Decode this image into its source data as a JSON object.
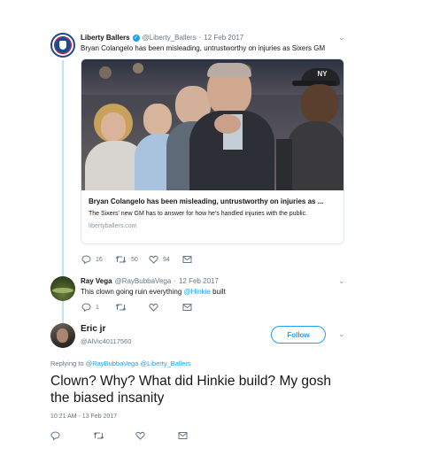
{
  "thread": [
    {
      "author_name": "Liberty Ballers",
      "verified": true,
      "handle": "@Liberty_Ballers",
      "date": "12 Feb 2017",
      "separator": "·",
      "text": "Bryan Colangelo has been misleading, untrustworthy on injuries as Sixers GM",
      "card": {
        "title": "Bryan Colangelo has been misleading, untrustworthy on injuries as ...",
        "description": "The Sixers' new GM has to answer for how he's handled injuries with the public.",
        "domain": "libertyballers.com",
        "image_cap_logo": "NY"
      },
      "actions": {
        "replies": "16",
        "retweets": "50",
        "likes": "94"
      }
    },
    {
      "author_name": "Ray Vega",
      "handle": "@RayBubbaVega",
      "date": "12 Feb 2017",
      "separator": "·",
      "text_before": "This clown going ruin everything ",
      "mention": "@Hinkie",
      "text_after": " built",
      "actions": {
        "replies": "1",
        "retweets": "",
        "likes": ""
      }
    }
  ],
  "main_tweet": {
    "author_name": "Eric jr",
    "handle": "@AlVic40117560",
    "follow_label": "Follow",
    "replying_prefix": "Replying to ",
    "replying_to_1": "@RayBubbaVega",
    "replying_to_2": "@Liberty_Ballers",
    "text": "Clown? Why? What did Hinkie build? My gosh the biased insanity",
    "timestamp": "10:21 AM - 13 Feb 2017"
  },
  "colors": {
    "link_blue": "#1da1f2",
    "muted_gray": "#657786",
    "thread_line": "#bfe3f7"
  },
  "icons": [
    "reply-icon",
    "retweet-icon",
    "like-icon",
    "message-icon",
    "chevron-down-icon",
    "verified-badge-icon"
  ]
}
